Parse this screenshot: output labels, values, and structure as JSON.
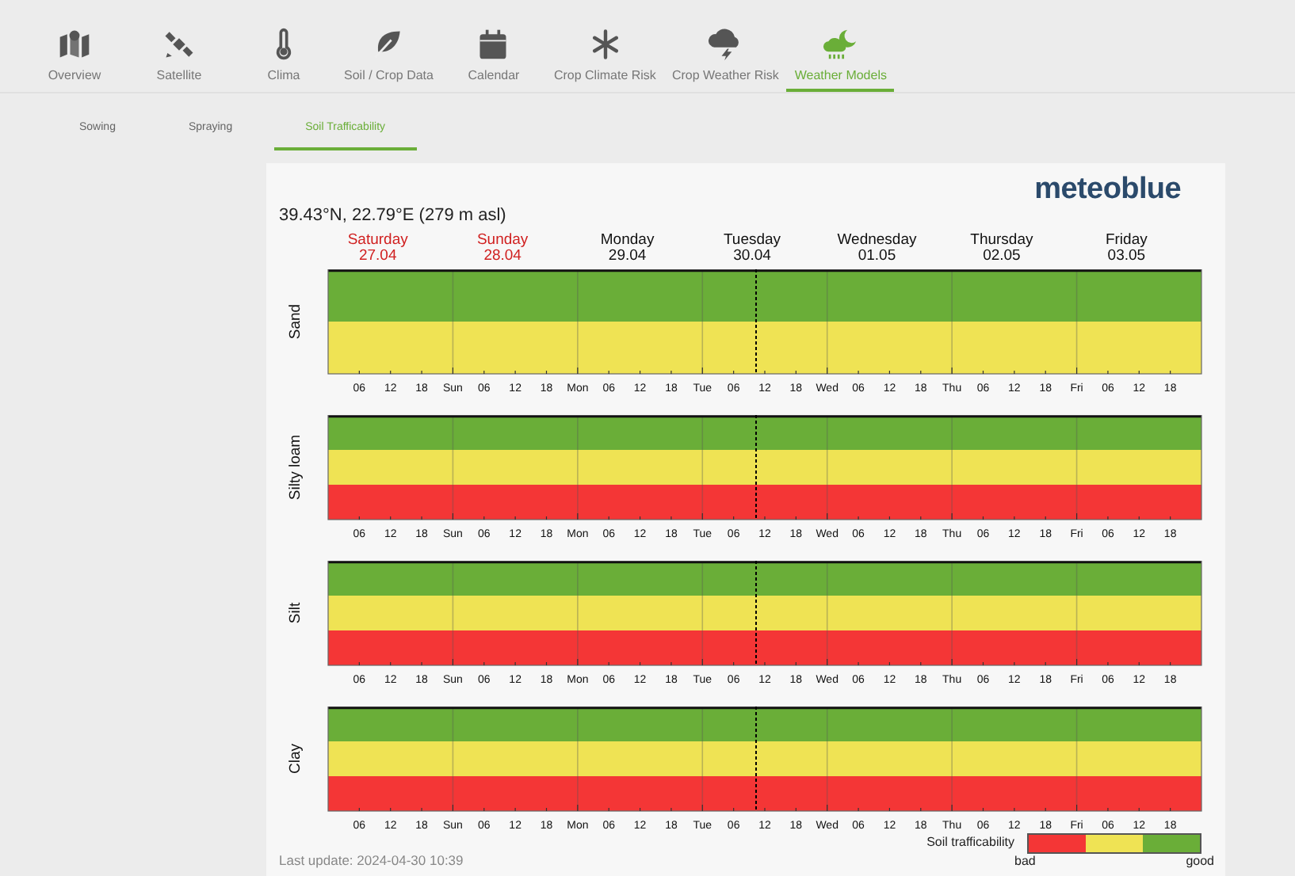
{
  "nav": [
    {
      "label": "Overview",
      "selected": false
    },
    {
      "label": "Satellite",
      "selected": false
    },
    {
      "label": "Clima",
      "selected": false
    },
    {
      "label": "Soil / Crop Data",
      "selected": false
    },
    {
      "label": "Calendar",
      "selected": false
    },
    {
      "label": "Crop Climate Risk",
      "selected": false
    },
    {
      "label": "Crop Weather Risk",
      "selected": false
    },
    {
      "label": "Weather Models",
      "selected": true
    }
  ],
  "subtabs": [
    {
      "label": "Sowing",
      "selected": false
    },
    {
      "label": "Spraying",
      "selected": false
    },
    {
      "label": "Soil Trafficability",
      "selected": true
    }
  ],
  "card": {
    "logo": "meteoblue",
    "location": "39.43°N, 22.79°E (279 m asl)",
    "days": [
      {
        "name": "Saturday",
        "date": "27.04",
        "weekend": true
      },
      {
        "name": "Sunday",
        "date": "28.04",
        "weekend": true
      },
      {
        "name": "Monday",
        "date": "29.04",
        "weekend": false
      },
      {
        "name": "Tuesday",
        "date": "30.04",
        "weekend": false
      },
      {
        "name": "Wednesday",
        "date": "01.05",
        "weekend": false
      },
      {
        "name": "Thursday",
        "date": "02.05",
        "weekend": false
      },
      {
        "name": "Friday",
        "date": "03.05",
        "weekend": false
      }
    ],
    "panels": [
      {
        "soil": "Sand",
        "bands": [
          {
            "color": "#6aae38"
          },
          {
            "color": "#efe354"
          }
        ],
        "ticks": [
          "06",
          "12",
          "18",
          "Sun",
          "06",
          "12",
          "18",
          "Mon",
          "06",
          "12",
          "18",
          "Tue",
          "06",
          "12",
          "18",
          "Wed",
          "06",
          "12",
          "18",
          "Thu",
          "06",
          "12",
          "18",
          "Fri",
          "06",
          "12",
          "18"
        ]
      },
      {
        "soil": "Silty loam",
        "bands": [
          {
            "color": "#6aae38"
          },
          {
            "color": "#efe354"
          },
          {
            "color": "#f43636"
          }
        ],
        "ticks": [
          "06",
          "12",
          "18",
          "Sun",
          "06",
          "12",
          "18",
          "Mon",
          "06",
          "12",
          "18",
          "Tue",
          "06",
          "12",
          "18",
          "Wed",
          "06",
          "12",
          "18",
          "Thu",
          "06",
          "12",
          "18",
          "Fri",
          "06",
          "12",
          "18"
        ]
      },
      {
        "soil": "Silt",
        "bands": [
          {
            "color": "#6aae38"
          },
          {
            "color": "#efe354"
          },
          {
            "color": "#f43636"
          }
        ],
        "ticks": [
          "06",
          "12",
          "18",
          "Sun",
          "06",
          "12",
          "18",
          "Mon",
          "06",
          "12",
          "18",
          "Tue",
          "06",
          "12",
          "18",
          "Wed",
          "06",
          "12",
          "18",
          "Thu",
          "06",
          "12",
          "18",
          "Fri",
          "06",
          "12",
          "18"
        ]
      },
      {
        "soil": "Clay",
        "bands": [
          {
            "color": "#6aae38"
          },
          {
            "color": "#efe354"
          },
          {
            "color": "#f43636"
          }
        ],
        "ticks": [
          "06",
          "12",
          "18",
          "Sun",
          "06",
          "12",
          "18",
          "Mon",
          "06",
          "12",
          "18",
          "Tue",
          "06",
          "12",
          "18",
          "Wed",
          "06",
          "12",
          "18",
          "Thu",
          "06",
          "12",
          "18",
          "Fri",
          "06",
          "12",
          "18"
        ]
      }
    ],
    "legend": {
      "title": "Soil trafficability",
      "low": "bad",
      "high": "good",
      "colors": [
        {
          "color": "#f43636"
        },
        {
          "color": "#efe354"
        },
        {
          "color": "#6aae38"
        }
      ]
    },
    "last_update": "Last update: 2024-04-30 10:39"
  }
}
